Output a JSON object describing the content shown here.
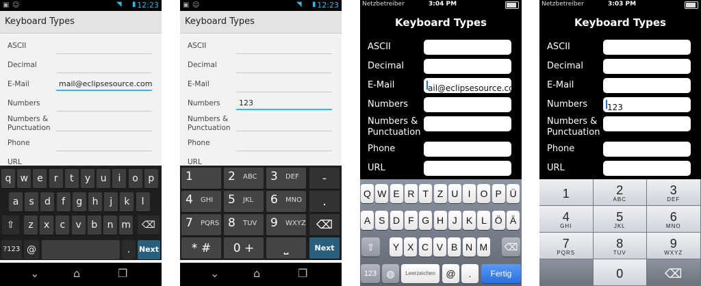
{
  "android": {
    "status_time": "12:23",
    "title": "Keyboard Types",
    "labels": [
      "ASCII",
      "Decimal",
      "E-Mail",
      "Numbers",
      "Numbers &",
      "Punctuation",
      "Phone",
      "URL"
    ],
    "email_value": "mail@eclipsesource.com",
    "numbers_value": "123",
    "qwerty": {
      "row1": [
        "q",
        "w",
        "e",
        "r",
        "t",
        "y",
        "u",
        "i",
        "o",
        "p"
      ],
      "row2": [
        "a",
        "s",
        "d",
        "f",
        "g",
        "h",
        "j",
        "k",
        "l"
      ],
      "row3": [
        "z",
        "x",
        "c",
        "v",
        "b",
        "n",
        "m"
      ],
      "sym": "?123",
      "at": "@",
      "dot": ".",
      "next": "Next",
      "shift": "⇧",
      "back": "⌫"
    },
    "numpad": {
      "keys": [
        {
          "d": "1",
          "s": ""
        },
        {
          "d": "2",
          "s": "ABC"
        },
        {
          "d": "3",
          "s": "DEF"
        },
        {
          "d": "-",
          "s": ""
        },
        {
          "d": "4",
          "s": "GHI"
        },
        {
          "d": "5",
          "s": "JKL"
        },
        {
          "d": "6",
          "s": "MNO"
        },
        {
          "d": ".",
          "s": ""
        },
        {
          "d": "7",
          "s": "PQRS"
        },
        {
          "d": "8",
          "s": "TUV"
        },
        {
          "d": "9",
          "s": "WXYZ"
        },
        {
          "d": "⌫",
          "s": ""
        },
        {
          "d": "* #",
          "s": ""
        },
        {
          "d": "0 +",
          "s": ""
        },
        {
          "d": "⎵",
          "s": ""
        },
        {
          "d": "Next",
          "s": ""
        }
      ]
    }
  },
  "ios": {
    "carrier": "Netzbetreiber",
    "time1": "3:04 PM",
    "time2": "3:03 PM",
    "title": "Keyboard Types",
    "labels": [
      "ASCII",
      "Decimal",
      "E-Mail",
      "Numbers",
      "Numbers &",
      "Punctuation",
      "Phone",
      "URL"
    ],
    "email_value": "ail@eclipsesource.com",
    "numbers_value": "123",
    "qwertz": {
      "row1": [
        "Q",
        "W",
        "E",
        "R",
        "T",
        "Z",
        "U",
        "I",
        "O",
        "P",
        "Ü"
      ],
      "row2": [
        "A",
        "S",
        "D",
        "F",
        "G",
        "H",
        "J",
        "K",
        "L",
        "Ö",
        "Ä"
      ],
      "row3": [
        "Y",
        "X",
        "C",
        "V",
        "B",
        "N",
        "M"
      ],
      "k123": "123",
      "space": "Leerzeichen",
      "at": "@",
      "dot": ".",
      "done": "Fertig",
      "shift": "⇧",
      "back": "⌫",
      "globe": "◍"
    },
    "numpad": {
      "keys": [
        {
          "d": "1",
          "s": ""
        },
        {
          "d": "2",
          "s": "ABC"
        },
        {
          "d": "3",
          "s": "DEF"
        },
        {
          "d": "4",
          "s": "GHI"
        },
        {
          "d": "5",
          "s": "JKL"
        },
        {
          "d": "6",
          "s": "MNO"
        },
        {
          "d": "7",
          "s": "PQRS"
        },
        {
          "d": "8",
          "s": "TUV"
        },
        {
          "d": "9",
          "s": "WXYZ"
        },
        {
          "d": "",
          "s": ""
        },
        {
          "d": "0",
          "s": ""
        },
        {
          "d": "⌫",
          "s": ""
        }
      ]
    }
  }
}
